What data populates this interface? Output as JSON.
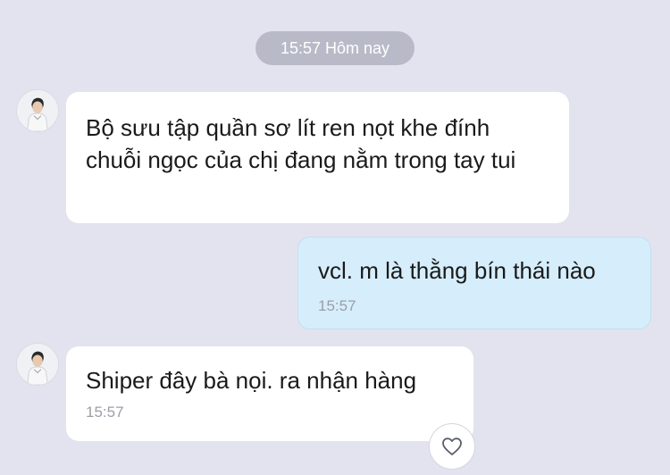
{
  "date_separator": "15:57 Hôm nay",
  "messages": [
    {
      "direction": "incoming",
      "text": "Bộ sưu tập quần sơ lít ren nọt khe đính chuỗi ngọc của chị đang nằm trong tay tui",
      "time": ""
    },
    {
      "direction": "outgoing",
      "text": "vcl. m là thằng bín thái nào",
      "time": "15:57"
    },
    {
      "direction": "incoming",
      "text": "Shiper đây bà nọi. ra nhận hàng",
      "time": "15:57"
    }
  ],
  "icons": {
    "avatar": "avatar-icon",
    "reaction": "heart-icon"
  },
  "colors": {
    "background": "#e3e3ef",
    "incoming_bubble": "#ffffff",
    "outgoing_bubble": "#d6eefb",
    "date_pill": "#b8bac8",
    "time_text": "#9b9ea8"
  }
}
